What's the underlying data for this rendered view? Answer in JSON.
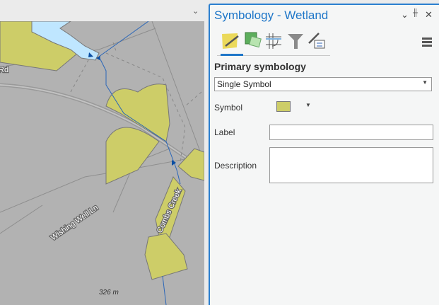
{
  "map": {
    "labels": {
      "road_partial": "Rd",
      "road": "Wishing Well Ln",
      "creek": "Combs Creek",
      "scale": "326 m"
    }
  },
  "panel": {
    "title": "Symbology - Wetland",
    "buttons": {
      "options": "⌄",
      "pin": "📌",
      "close": "✕"
    },
    "tabs": [
      "primary-symbology",
      "vary-symbology",
      "symbol-layer-drawing",
      "label-classes",
      "symbol-properties"
    ],
    "section_heading": "Primary symbology",
    "symbology_type": "Single Symbol",
    "symbol_label": "Symbol",
    "symbol_color": "#cdcd68",
    "label_label": "Label",
    "label_value": "",
    "description_label": "Description",
    "description_value": ""
  }
}
